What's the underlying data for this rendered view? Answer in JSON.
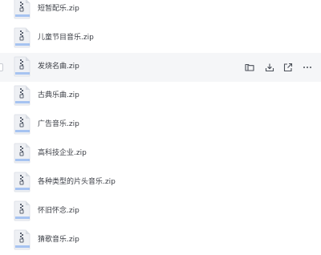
{
  "files": [
    {
      "name": "短暂配乐.zip"
    },
    {
      "name": "儿童节目音乐.zip"
    },
    {
      "name": "发烧名曲.zip",
      "hovered": true
    },
    {
      "name": "古典乐曲.zip"
    },
    {
      "name": "广告音乐.zip"
    },
    {
      "name": "高科技企业.zip"
    },
    {
      "name": "各种类型的片头音乐.zip"
    },
    {
      "name": "怀旧怀念.zip"
    },
    {
      "name": "猜歌音乐.zip"
    }
  ],
  "row_actions": [
    {
      "icon": "folder-icon"
    },
    {
      "icon": "download-icon"
    },
    {
      "icon": "share-icon"
    },
    {
      "icon": "more-icon"
    }
  ],
  "colors": {
    "hover_row": "#f5f6f8",
    "icon_body": "#eef0f4",
    "icon_fold": "#d8dce3",
    "icon_zip": "#5b6270"
  }
}
